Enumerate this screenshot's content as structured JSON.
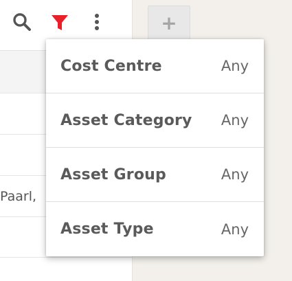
{
  "toolbar": {
    "icons": [
      "search-icon",
      "filter-icon",
      "more-vertical-icon"
    ],
    "filter_active_color": "#e8202a",
    "icon_color": "#555555"
  },
  "list": {
    "rows": [
      "",
      "",
      "",
      "Paarl,",
      ""
    ]
  },
  "add_button": {
    "label": "+"
  },
  "filter_menu": {
    "items": [
      {
        "label": "Cost Centre",
        "value": "Any"
      },
      {
        "label": "Asset Category",
        "value": "Any"
      },
      {
        "label": "Asset Group",
        "value": "Any"
      },
      {
        "label": "Asset Type",
        "value": "Any"
      }
    ]
  }
}
